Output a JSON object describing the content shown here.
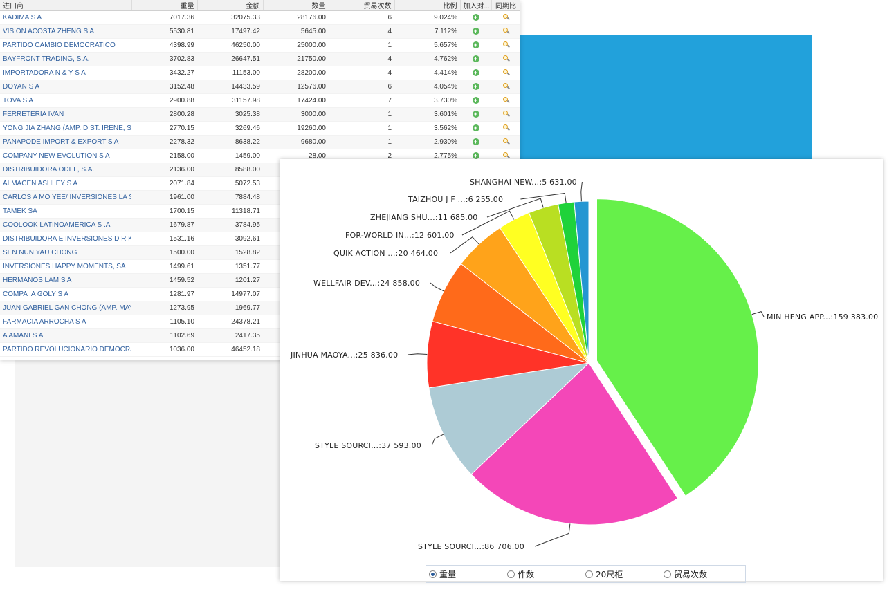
{
  "table": {
    "headers": [
      "进口商",
      "重量",
      "金额",
      "数量",
      "贸易次数",
      "比例",
      "加入对...",
      "同期比"
    ],
    "rows": [
      [
        "KADIMA S A",
        "7017.36",
        "32075.33",
        "28176.00",
        "6",
        "9.024%"
      ],
      [
        "VISION ACOSTA ZHENG S A",
        "5530.81",
        "17497.42",
        "5645.00",
        "4",
        "7.112%"
      ],
      [
        "PARTIDO CAMBIO DEMOCRATICO",
        "4398.99",
        "46250.00",
        "25000.00",
        "1",
        "5.657%"
      ],
      [
        "BAYFRONT TRADING, S.A.",
        "3702.83",
        "26647.51",
        "21750.00",
        "4",
        "4.762%"
      ],
      [
        "IMPORTADORA N & Y S A",
        "3432.27",
        "11153.00",
        "28200.00",
        "4",
        "4.414%"
      ],
      [
        "DOYAN S A",
        "3152.48",
        "14433.59",
        "12576.00",
        "6",
        "4.054%"
      ],
      [
        "TOVA S A",
        "2900.88",
        "31157.98",
        "17424.00",
        "7",
        "3.730%"
      ],
      [
        "FERRETERIA IVAN",
        "2800.28",
        "3025.38",
        "3000.00",
        "1",
        "3.601%"
      ],
      [
        "YONG JIA ZHANG (AMP. DIST. IRENE, S....",
        "2770.15",
        "3269.46",
        "19260.00",
        "1",
        "3.562%"
      ],
      [
        "PANAPODE IMPORT & EXPORT S A",
        "2278.32",
        "8638.22",
        "9680.00",
        "1",
        "2.930%"
      ],
      [
        "COMPANY NEW EVOLUTION S A",
        "2158.00",
        "1459.00",
        "28.00",
        "2",
        "2.775%"
      ],
      [
        "DISTRIBUIDORA ODEL, S.A.",
        "2136.00",
        "8588.00",
        "",
        "",
        ""
      ],
      [
        "ALMACEN ASHLEY S A",
        "2071.84",
        "5072.53",
        "",
        "",
        ""
      ],
      [
        "CARLOS A MO YEE/ INVERSIONES LA SI...",
        "1961.00",
        "7884.48",
        "",
        "",
        ""
      ],
      [
        "TAMEK SA",
        "1700.15",
        "11318.71",
        "",
        "",
        ""
      ],
      [
        "COOLOOK LATINOAMERICA S .A",
        "1679.87",
        "3784.95",
        "",
        "",
        ""
      ],
      [
        "DISTRIBUIDORA E INVERSIONES D R K ...",
        "1531.16",
        "3092.61",
        "",
        "",
        ""
      ],
      [
        "SEN NUN YAU CHONG",
        "1500.00",
        "1528.82",
        "",
        "",
        ""
      ],
      [
        "INVERSIONES HAPPY MOMENTS, SA",
        "1499.61",
        "1351.77",
        "",
        "",
        ""
      ],
      [
        "HERMANOS LAM S A",
        "1459.52",
        "1201.27",
        "",
        "",
        ""
      ],
      [
        "COMPA IA GOLY S A",
        "1281.97",
        "14977.07",
        "",
        "",
        ""
      ],
      [
        "JUAN GABRIEL GAN CHONG (AMP. MAYO...",
        "1273.95",
        "1969.77",
        "",
        "",
        ""
      ],
      [
        "FARMACIA ARROCHA S A",
        "1105.10",
        "24378.21",
        "",
        "",
        ""
      ],
      [
        "A AMANI S A",
        "1102.69",
        "2417.35",
        "",
        "",
        ""
      ],
      [
        "PARTIDO REVOLUCIONARIO DEMOCRAT...",
        "1036.00",
        "46452.18",
        "",
        "",
        ""
      ]
    ],
    "add_icon": "plus-circle-icon",
    "compare_icon": "magnifier-icon"
  },
  "chart_data": {
    "type": "pie",
    "slices": [
      {
        "label": "MIN HENG APP...",
        "value": 159383.0,
        "display": "MIN HENG APP...:159 383.00",
        "color": "#66f04a",
        "exploded": true
      },
      {
        "label": "STYLE SOURCI...",
        "value": 86706.0,
        "display": "STYLE SOURCI...:86 706.00",
        "color": "#f447b8"
      },
      {
        "label": "STYLE SOURCI...",
        "value": 37593.0,
        "display": "STYLE SOURCI...:37 593.00",
        "color": "#adcbd5"
      },
      {
        "label": "JINHUA MAOYA...",
        "value": 25836.0,
        "display": "JINHUA MAOYA...:25 836.00",
        "color": "#ff3328"
      },
      {
        "label": "WELLFAIR DEV...",
        "value": 24858.0,
        "display": "WELLFAIR DEV...:24 858.00",
        "color": "#ff6a1a"
      },
      {
        "label": "QUIK ACTION ...",
        "value": 20464.0,
        "display": "QUIK ACTION ...:20 464.00",
        "color": "#ffa31a"
      },
      {
        "label": "FOR-WORLD IN...",
        "value": 12601.0,
        "display": "FOR-WORLD IN...:12 601.00",
        "color": "#ffff22"
      },
      {
        "label": "ZHEJIANG SHU...",
        "value": 11685.0,
        "display": "ZHEJIANG SHU...:11 685.00",
        "color": "#b9df22"
      },
      {
        "label": "TAIZHOU J F ...",
        "value": 6255.0,
        "display": "TAIZHOU J F ...:6 255.00",
        "color": "#1fd23a"
      },
      {
        "label": "SHANGHAI NEW...",
        "value": 5631.0,
        "display": "SHANGHAI NEW...:5 631.00",
        "color": "#2596d2"
      }
    ]
  },
  "legend": {
    "options": [
      "重量",
      "件数",
      "20尺柜",
      "贸易次数"
    ],
    "selected": 0
  }
}
